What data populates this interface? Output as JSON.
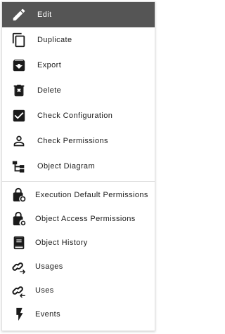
{
  "menu": {
    "items": [
      {
        "label": "Edit",
        "icon": "pencil-icon"
      },
      {
        "label": "Duplicate",
        "icon": "copy-icon"
      },
      {
        "label": "Export",
        "icon": "archive-icon"
      },
      {
        "label": "Delete",
        "icon": "trash-icon"
      },
      {
        "label": "Check Configuration",
        "icon": "checkbox-checked-icon"
      },
      {
        "label": "Check Permissions",
        "icon": "person-icon"
      },
      {
        "label": "Object Diagram",
        "icon": "sitemap-icon"
      },
      {
        "label": "Execution Default Permissions",
        "icon": "lock-link-icon"
      },
      {
        "label": "Object Access Permissions",
        "icon": "lock-shield-icon"
      },
      {
        "label": "Object History",
        "icon": "book-icon"
      },
      {
        "label": "Usages",
        "icon": "link-arrow-right-icon"
      },
      {
        "label": "Uses",
        "icon": "link-arrow-left-icon"
      },
      {
        "label": "Events",
        "icon": "lightning-icon"
      }
    ]
  },
  "colors": {
    "active_background": "#555555",
    "active_text": "#ffffff",
    "text": "#1c1c1c",
    "icon": "#1a1a1a"
  }
}
